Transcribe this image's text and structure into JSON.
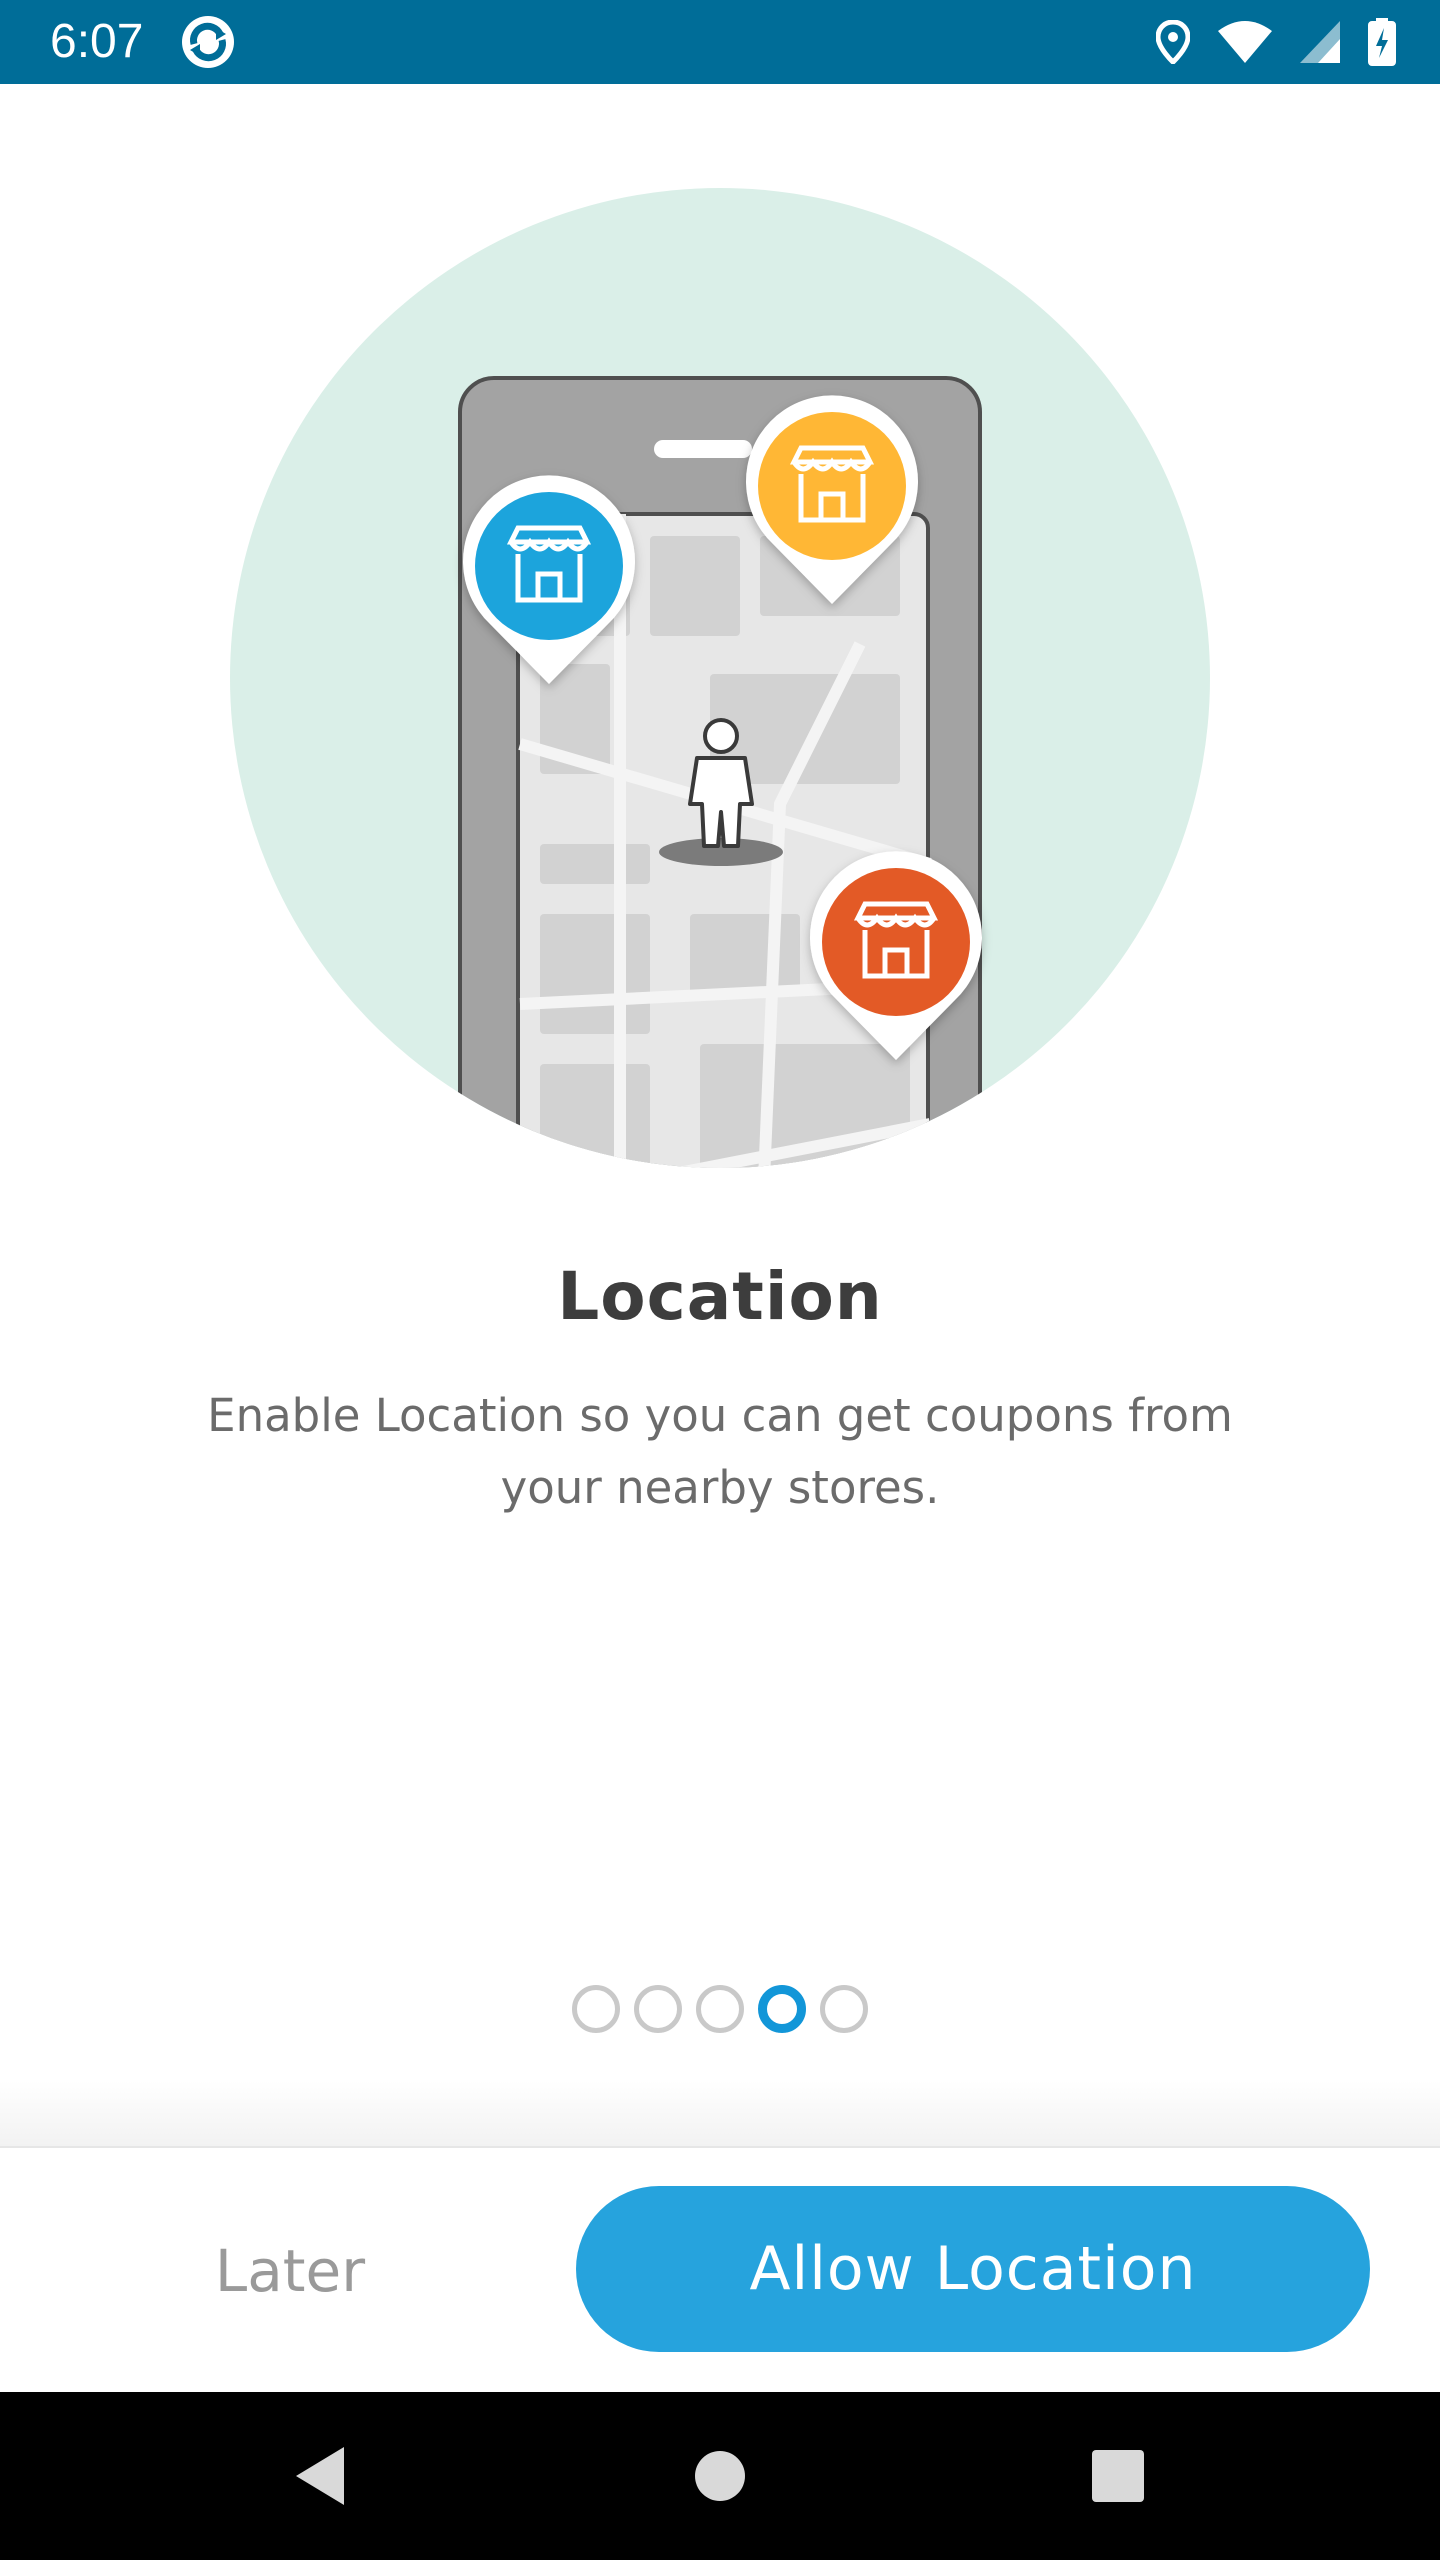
{
  "status_bar": {
    "time": "6:07",
    "icons": [
      "app-notification-icon",
      "location-icon",
      "wifi-icon",
      "cell-signal-icon",
      "battery-charging-icon"
    ],
    "background": "#006d98"
  },
  "onboarding": {
    "illustration": "phone-map-stores-illustration",
    "title": "Location",
    "description": "Enable Location so you can get coupons from your nearby stores.",
    "pager": {
      "total": 5,
      "active_index": 3
    }
  },
  "actions": {
    "later_label": "Later",
    "allow_label": "Allow Location",
    "accent_color": "#26a3dd"
  },
  "navigation_bar": {
    "buttons": [
      "back-icon",
      "home-icon",
      "recents-icon"
    ]
  }
}
